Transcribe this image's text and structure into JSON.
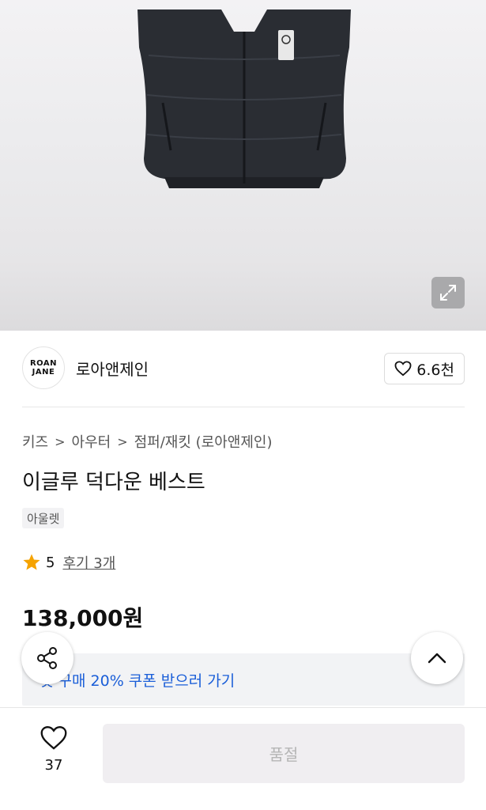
{
  "brand": {
    "logo_line1": "ROAN",
    "logo_line2": "JANE",
    "name": "로아앤제인",
    "like_count": "6.6천"
  },
  "breadcrumb": [
    "키즈",
    "아우터",
    "점퍼/재킷 (로아앤제인)"
  ],
  "product": {
    "title": "이글루 덕다운 베스트",
    "tag": "아울렛",
    "rating": "5",
    "reviews_label": "후기 3개",
    "price": "138,000원"
  },
  "coupon": {
    "text": "첫 구매 20% 쿠폰 받으러 가기",
    "arrow": "›"
  },
  "bottom": {
    "wish_count": "37",
    "soldout_label": "품절"
  },
  "colors": {
    "accent_blue": "#1a5ed8",
    "star": "#f5a300",
    "vest": "#2a2d33"
  },
  "icons": [
    "expand-icon",
    "heart-icon",
    "star-icon",
    "share-icon",
    "chevron-up-icon",
    "chevron-right-icon"
  ]
}
